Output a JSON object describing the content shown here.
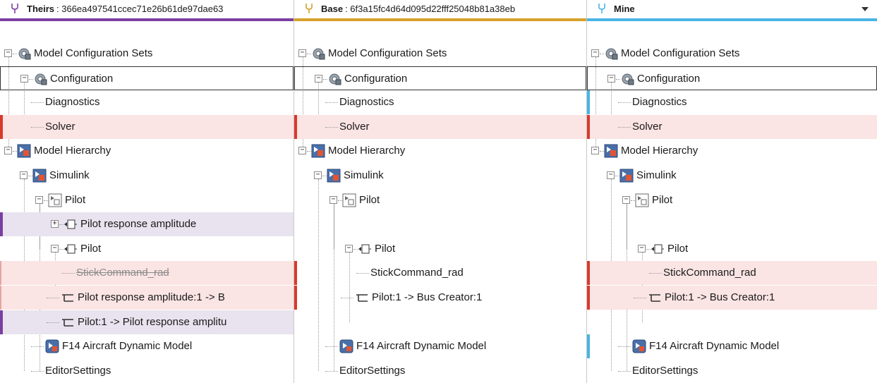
{
  "panes": [
    {
      "key": "theirs",
      "label": "Theirs",
      "hash": ": 366ea497541ccec71e26b61de97dae63"
    },
    {
      "key": "base",
      "label": "Base",
      "hash": ": 6f3a15fc4d64d095d22fff25048b81a38eb"
    },
    {
      "key": "mine",
      "label": "Mine",
      "hash": ""
    }
  ],
  "colors": {
    "theirs": "#7a3fa0",
    "base": "#d6a02a",
    "mine": "#49b4e6",
    "conflict_red": "#d93a2b",
    "row_red_bg": "#fbe4e4",
    "row_purple_bg": "#e8e3ee"
  },
  "trees": {
    "theirs": [
      {
        "text": "Model Configuration Sets",
        "icon": "config-sets-icon",
        "expander": "minus"
      },
      {
        "text": "Configuration",
        "icon": "config-gear-icon",
        "expander": "minus"
      },
      {
        "text": "Diagnostics",
        "icon": "",
        "expander": ""
      },
      {
        "text": "Solver",
        "icon": "",
        "expander": ""
      },
      {
        "text": "Model Hierarchy",
        "icon": "model-block-icon",
        "expander": "minus"
      },
      {
        "text": "Simulink",
        "icon": "model-block-icon",
        "expander": "minus"
      },
      {
        "text": "Pilot",
        "icon": "subsystem-icon",
        "expander": "minus"
      },
      {
        "text": "Pilot response amplitude",
        "icon": "port-block-icon",
        "expander": "plus"
      },
      {
        "text": "Pilot",
        "icon": "port-block-icon",
        "expander": "minus"
      },
      {
        "text": "StickCommand_rad",
        "icon": "",
        "expander": ""
      },
      {
        "text": "Pilot response amplitude:1 -> B",
        "icon": "line-icon",
        "expander": ""
      },
      {
        "text": "Pilot:1 -> Pilot response amplitu",
        "icon": "line-icon",
        "expander": ""
      },
      {
        "text": "F14 Aircraft Dynamic Model",
        "icon": "model-ref-icon",
        "expander": ""
      },
      {
        "text": "EditorSettings",
        "icon": "",
        "expander": ""
      }
    ],
    "base": [
      {
        "text": "Model Configuration Sets",
        "icon": "config-sets-icon",
        "expander": "minus"
      },
      {
        "text": "Configuration",
        "icon": "config-gear-icon",
        "expander": "minus"
      },
      {
        "text": "Diagnostics",
        "icon": "",
        "expander": ""
      },
      {
        "text": "Solver",
        "icon": "",
        "expander": ""
      },
      {
        "text": "Model Hierarchy",
        "icon": "model-block-icon",
        "expander": "minus"
      },
      {
        "text": "Simulink",
        "icon": "model-block-icon",
        "expander": "minus"
      },
      {
        "text": "Pilot",
        "icon": "subsystem-icon",
        "expander": "minus"
      },
      {
        "text": "",
        "icon": "",
        "expander": ""
      },
      {
        "text": "Pilot",
        "icon": "port-block-icon",
        "expander": "minus"
      },
      {
        "text": "StickCommand_rad",
        "icon": "",
        "expander": ""
      },
      {
        "text": "Pilot:1 -> Bus Creator:1",
        "icon": "line-icon",
        "expander": ""
      },
      {
        "text": "",
        "icon": "",
        "expander": ""
      },
      {
        "text": "F14 Aircraft Dynamic Model",
        "icon": "model-ref-icon",
        "expander": ""
      },
      {
        "text": "EditorSettings",
        "icon": "",
        "expander": ""
      }
    ],
    "mine": [
      {
        "text": "Model Configuration Sets",
        "icon": "config-sets-icon",
        "expander": "minus"
      },
      {
        "text": "Configuration",
        "icon": "config-gear-icon",
        "expander": "minus"
      },
      {
        "text": "Diagnostics",
        "icon": "",
        "expander": ""
      },
      {
        "text": "Solver",
        "icon": "",
        "expander": ""
      },
      {
        "text": "Model Hierarchy",
        "icon": "model-block-icon",
        "expander": "minus"
      },
      {
        "text": "Simulink",
        "icon": "model-block-icon",
        "expander": "minus"
      },
      {
        "text": "Pilot",
        "icon": "subsystem-icon",
        "expander": "minus"
      },
      {
        "text": "",
        "icon": "",
        "expander": ""
      },
      {
        "text": "Pilot",
        "icon": "port-block-icon",
        "expander": "minus"
      },
      {
        "text": "StickCommand_rad",
        "icon": "",
        "expander": ""
      },
      {
        "text": "Pilot:1 -> Bus Creator:1",
        "icon": "line-icon",
        "expander": ""
      },
      {
        "text": "",
        "icon": "",
        "expander": ""
      },
      {
        "text": "F14 Aircraft Dynamic Model",
        "icon": "model-ref-icon",
        "expander": ""
      },
      {
        "text": "EditorSettings",
        "icon": "",
        "expander": ""
      }
    ]
  }
}
